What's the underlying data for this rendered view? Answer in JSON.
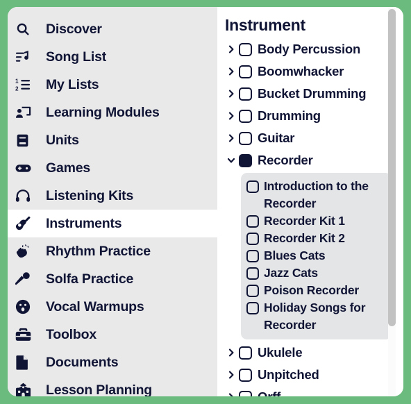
{
  "theme": {
    "frame_green": "#6cbb7e",
    "sidebar_bg": "#e9e9ea",
    "text_dark": "#111535",
    "sublist_bg": "#e4e5e6",
    "scrollbar_thumb": "#c2c2c2"
  },
  "sidebar": {
    "items": [
      {
        "label": "Discover",
        "icon": "search-icon",
        "active": false
      },
      {
        "label": "Song List",
        "icon": "song-list-icon",
        "active": false
      },
      {
        "label": "My Lists",
        "icon": "numbered-list-icon",
        "active": false
      },
      {
        "label": "Learning Modules",
        "icon": "presentation-icon",
        "active": false
      },
      {
        "label": "Units",
        "icon": "book-icon",
        "active": false
      },
      {
        "label": "Games",
        "icon": "gamepad-icon",
        "active": false
      },
      {
        "label": "Listening Kits",
        "icon": "headphones-icon",
        "active": false
      },
      {
        "label": "Instruments",
        "icon": "guitar-icon",
        "active": true
      },
      {
        "label": "Rhythm Practice",
        "icon": "clapping-hands-icon",
        "active": false
      },
      {
        "label": "Solfa Practice",
        "icon": "microphone-icon",
        "active": false
      },
      {
        "label": "Vocal Warmups",
        "icon": "singing-face-icon",
        "active": false
      },
      {
        "label": "Toolbox",
        "icon": "toolbox-icon",
        "active": false
      },
      {
        "label": "Documents",
        "icon": "document-icon",
        "active": false
      },
      {
        "label": "Lesson Planning",
        "icon": "school-building-icon",
        "active": false
      }
    ]
  },
  "panel": {
    "title": "Instrument",
    "tree": [
      {
        "label": "Body Percussion",
        "expanded": false,
        "checked": false
      },
      {
        "label": "Boomwhacker",
        "expanded": false,
        "checked": false
      },
      {
        "label": "Bucket Drumming",
        "expanded": false,
        "checked": false
      },
      {
        "label": "Drumming",
        "expanded": false,
        "checked": false
      },
      {
        "label": "Guitar",
        "expanded": false,
        "checked": false
      },
      {
        "label": "Recorder",
        "expanded": true,
        "checked": true
      },
      {
        "label": "Ukulele",
        "expanded": false,
        "checked": false
      },
      {
        "label": "Unpitched",
        "expanded": false,
        "checked": false
      },
      {
        "label": "Orff",
        "expanded": false,
        "checked": false
      }
    ],
    "recorder_children": [
      {
        "label": "Introduction to the Recorder",
        "checked": false
      },
      {
        "label": "Recorder Kit 1",
        "checked": false
      },
      {
        "label": "Recorder Kit 2",
        "checked": false
      },
      {
        "label": "Blues Cats",
        "checked": false
      },
      {
        "label": "Jazz Cats",
        "checked": false
      },
      {
        "label": "Poison Recorder",
        "checked": false
      },
      {
        "label": "Holiday Songs for Recorder",
        "checked": false
      }
    ],
    "chevron_collapsed": "›",
    "chevron_expanded": "⌄"
  }
}
